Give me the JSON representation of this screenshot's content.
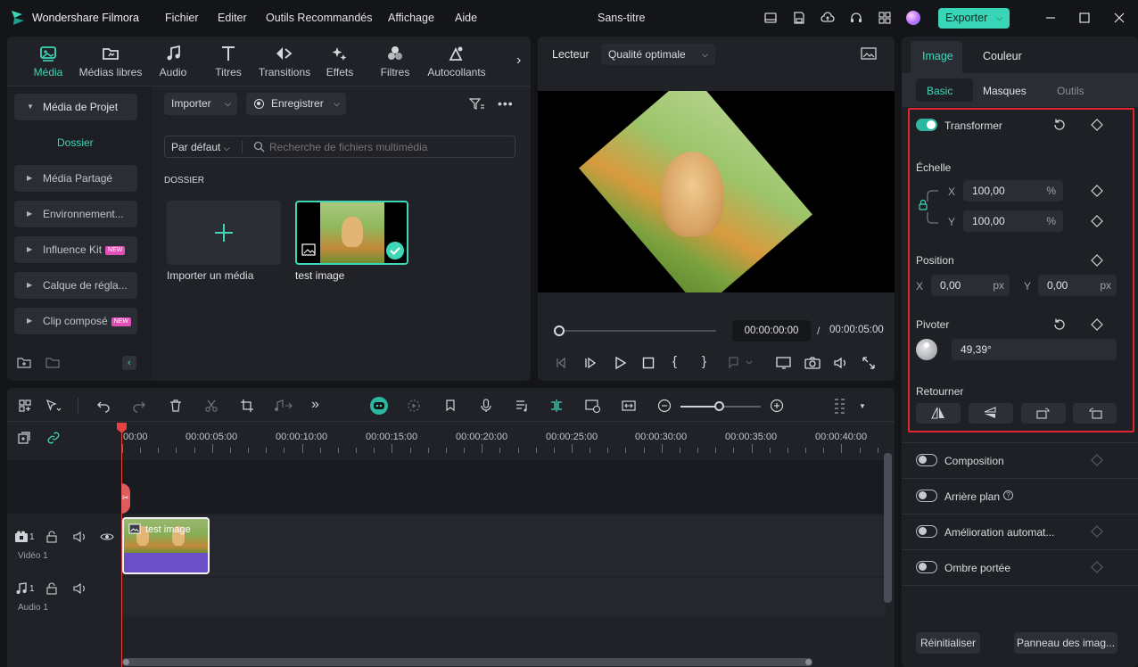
{
  "app": {
    "name": "Wondershare Filmora",
    "document_title": "Sans-titre",
    "menu": [
      "Fichier",
      "Editer",
      "Outils Recommandés",
      "Affichage",
      "Aide"
    ],
    "export_label": "Exporter"
  },
  "media_toolbar": {
    "tabs": [
      {
        "label": "Média",
        "icon": "media-icon",
        "active": true
      },
      {
        "label": "Médias libres",
        "icon": "stock-media-icon"
      },
      {
        "label": "Audio",
        "icon": "music-note-icon"
      },
      {
        "label": "Titres",
        "icon": "text-t-icon"
      },
      {
        "label": "Transitions",
        "icon": "transitions-icon"
      },
      {
        "label": "Effets",
        "icon": "effects-icon"
      },
      {
        "label": "Filtres",
        "icon": "filters-icon"
      },
      {
        "label": "Autocollants",
        "icon": "stickers-icon"
      }
    ]
  },
  "sidebar": {
    "project_media": "Média de Projet",
    "folder": "Dossier",
    "items": [
      {
        "label": "Média Partagé",
        "new": false
      },
      {
        "label": "Environnement...",
        "new": false
      },
      {
        "label": "Influence Kit",
        "new": true
      },
      {
        "label": "Calque de régla...",
        "new": false
      },
      {
        "label": "Clip composé",
        "new": true
      }
    ],
    "new_badge": "NEW"
  },
  "library": {
    "import_label": "Importer",
    "record_label": "Enregistrer",
    "sort_label": "Par défaut",
    "search_placeholder": "Recherche de fichiers multimédia",
    "section_label": "DOSSIER",
    "import_media_label": "Importer un média",
    "clip_name": "test image"
  },
  "player": {
    "label": "Lecteur",
    "quality": "Qualité optimale",
    "current_time": "00:00:00:00",
    "separator": "/",
    "total_time": "00:00:05:00",
    "progress": 0.0
  },
  "timeline": {
    "ticks": [
      "00:00",
      "00:00:05:00",
      "00:00:10:00",
      "00:00:15:00",
      "00:00:20:00",
      "00:00:25:00",
      "00:00:30:00",
      "00:00:35:00",
      "00:00:40:00"
    ],
    "video_track_num": "1",
    "video_track_label": "Vidéo 1",
    "audio_track_num": "1",
    "audio_track_label": "Audio 1",
    "clip_label": "test image"
  },
  "properties": {
    "tabs": [
      "Image",
      "Couleur"
    ],
    "subtabs": [
      "Basic",
      "Masques",
      "Outils"
    ],
    "transform_label": "Transformer",
    "scale_label": "Échelle",
    "scale_x_axis": "X",
    "scale_y_axis": "Y",
    "scale_x": "100,00",
    "scale_y": "100,00",
    "percent": "%",
    "position_label": "Position",
    "pos_x_axis": "X",
    "pos_y_axis": "Y",
    "pos_x": "0,00",
    "pos_y": "0,00",
    "px": "px",
    "rotate_label": "Pivoter",
    "rotate_value": "49,39°",
    "flip_label": "Retourner",
    "composition_label": "Composition",
    "background_label": "Arrière plan",
    "auto_enhance_label": "Amélioration automat...",
    "shadow_label": "Ombre portée",
    "reset_label": "Réinitialiser",
    "image_panel_label": "Panneau des imag..."
  },
  "colors": {
    "accent": "#2bb8a0",
    "highlight_border": "#e0262e",
    "clip_purple": "#6a4fc6",
    "playhead": "#e8423f"
  }
}
